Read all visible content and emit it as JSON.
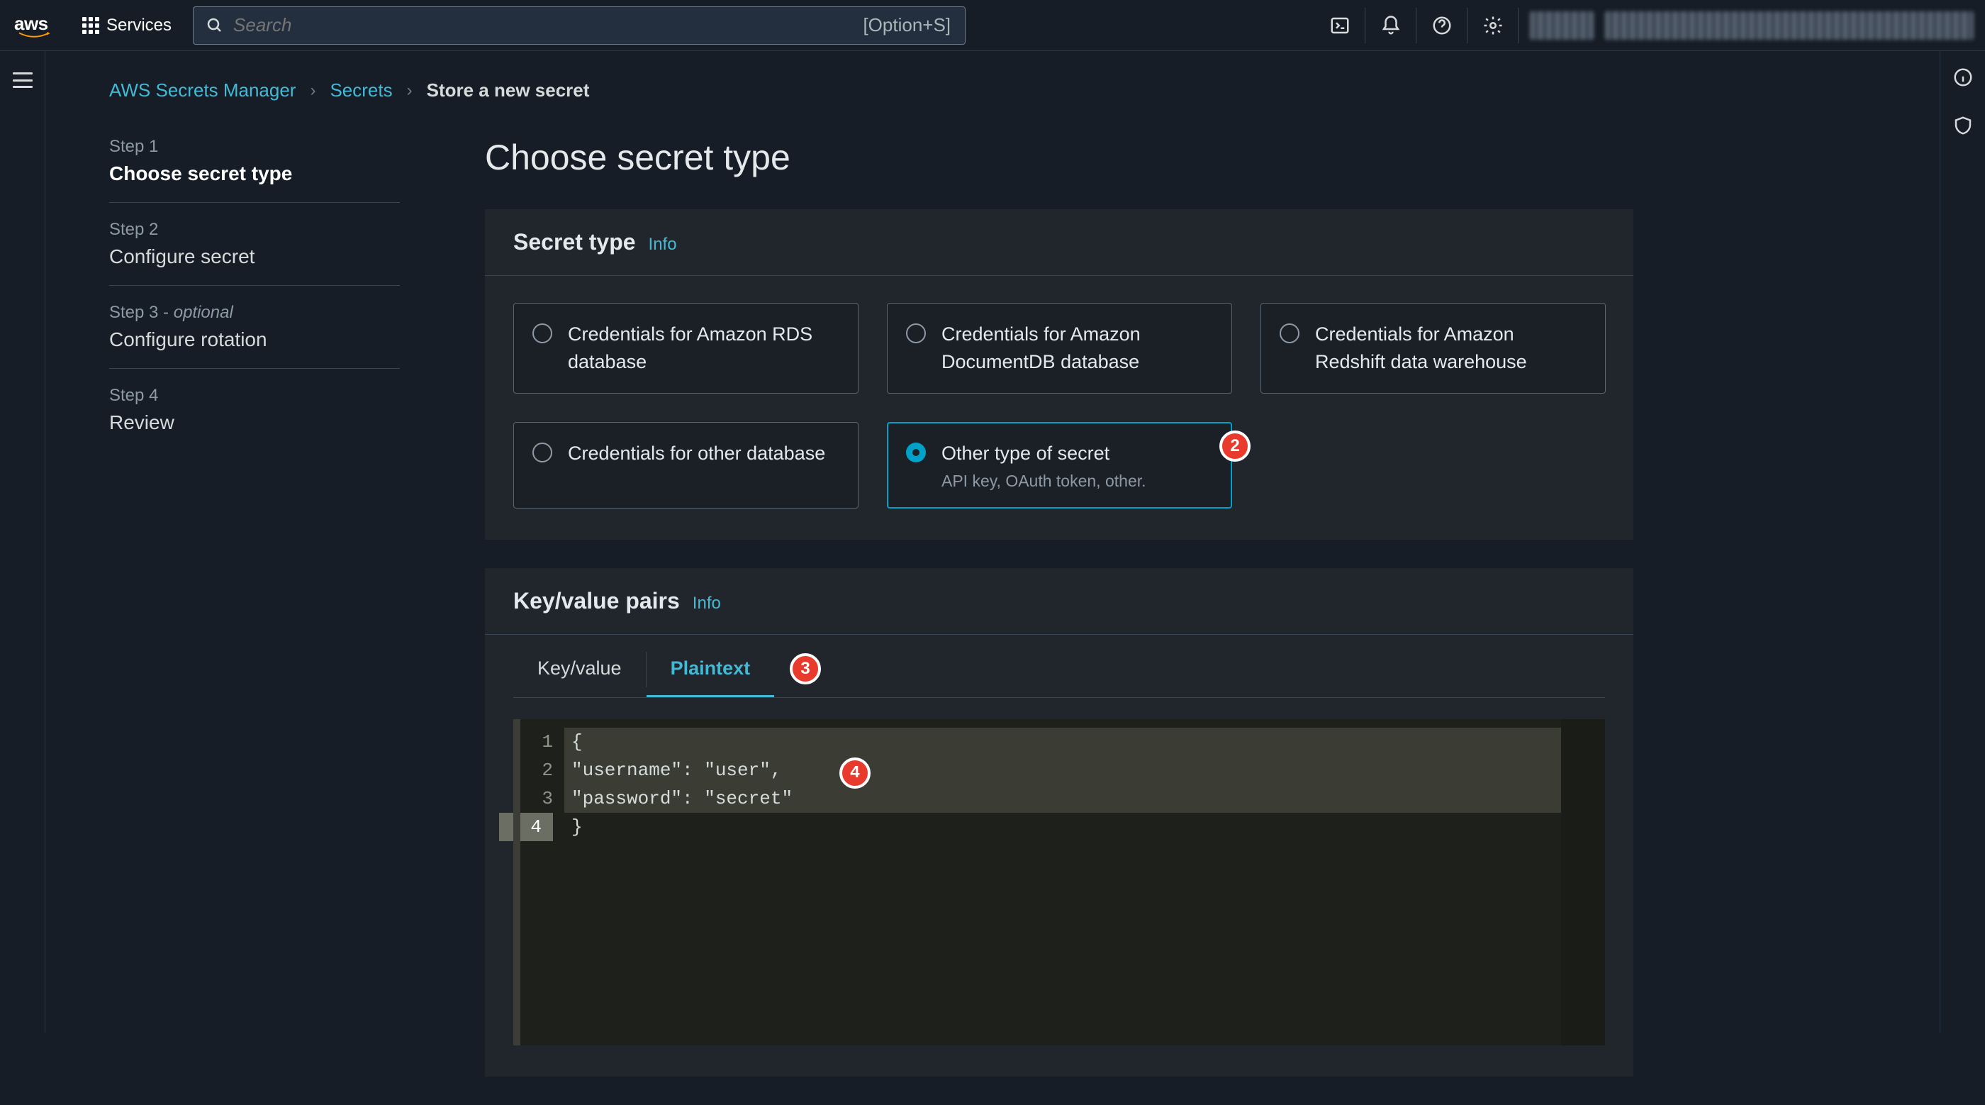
{
  "topnav": {
    "services_label": "Services",
    "search_placeholder": "Search",
    "search_hint": "[Option+S]"
  },
  "breadcrumb": {
    "service": "AWS Secrets Manager",
    "parent": "Secrets",
    "current": "Store a new secret"
  },
  "wizard_steps": [
    {
      "num": "Step 1",
      "title": "Choose secret type",
      "active": true
    },
    {
      "num": "Step 2",
      "title": "Configure secret",
      "active": false
    },
    {
      "num": "Step 3 - ",
      "opt": "optional",
      "title": "Configure rotation",
      "active": false
    },
    {
      "num": "Step 4",
      "title": "Review",
      "active": false
    }
  ],
  "page_title": "Choose secret type",
  "panels": {
    "secret_type": {
      "title": "Secret type",
      "info": "Info",
      "options": [
        {
          "label": "Credentials for Amazon RDS database",
          "sub": "",
          "selected": false
        },
        {
          "label": "Credentials for Amazon DocumentDB database",
          "sub": "",
          "selected": false
        },
        {
          "label": "Credentials for Amazon Redshift data warehouse",
          "sub": "",
          "selected": false
        },
        {
          "label": "Credentials for other database",
          "sub": "",
          "selected": false
        },
        {
          "label": "Other type of secret",
          "sub": "API key, OAuth token, other.",
          "selected": true
        }
      ]
    },
    "kv": {
      "title": "Key/value pairs",
      "info": "Info",
      "tabs": {
        "kv": "Key/value",
        "pt": "Plaintext"
      },
      "code_lines": [
        "{",
        "  \"username\": \"user\",",
        "  \"password\": \"secret\"",
        "}"
      ]
    }
  },
  "annotations": {
    "2": "2",
    "3": "3",
    "4": "4"
  }
}
